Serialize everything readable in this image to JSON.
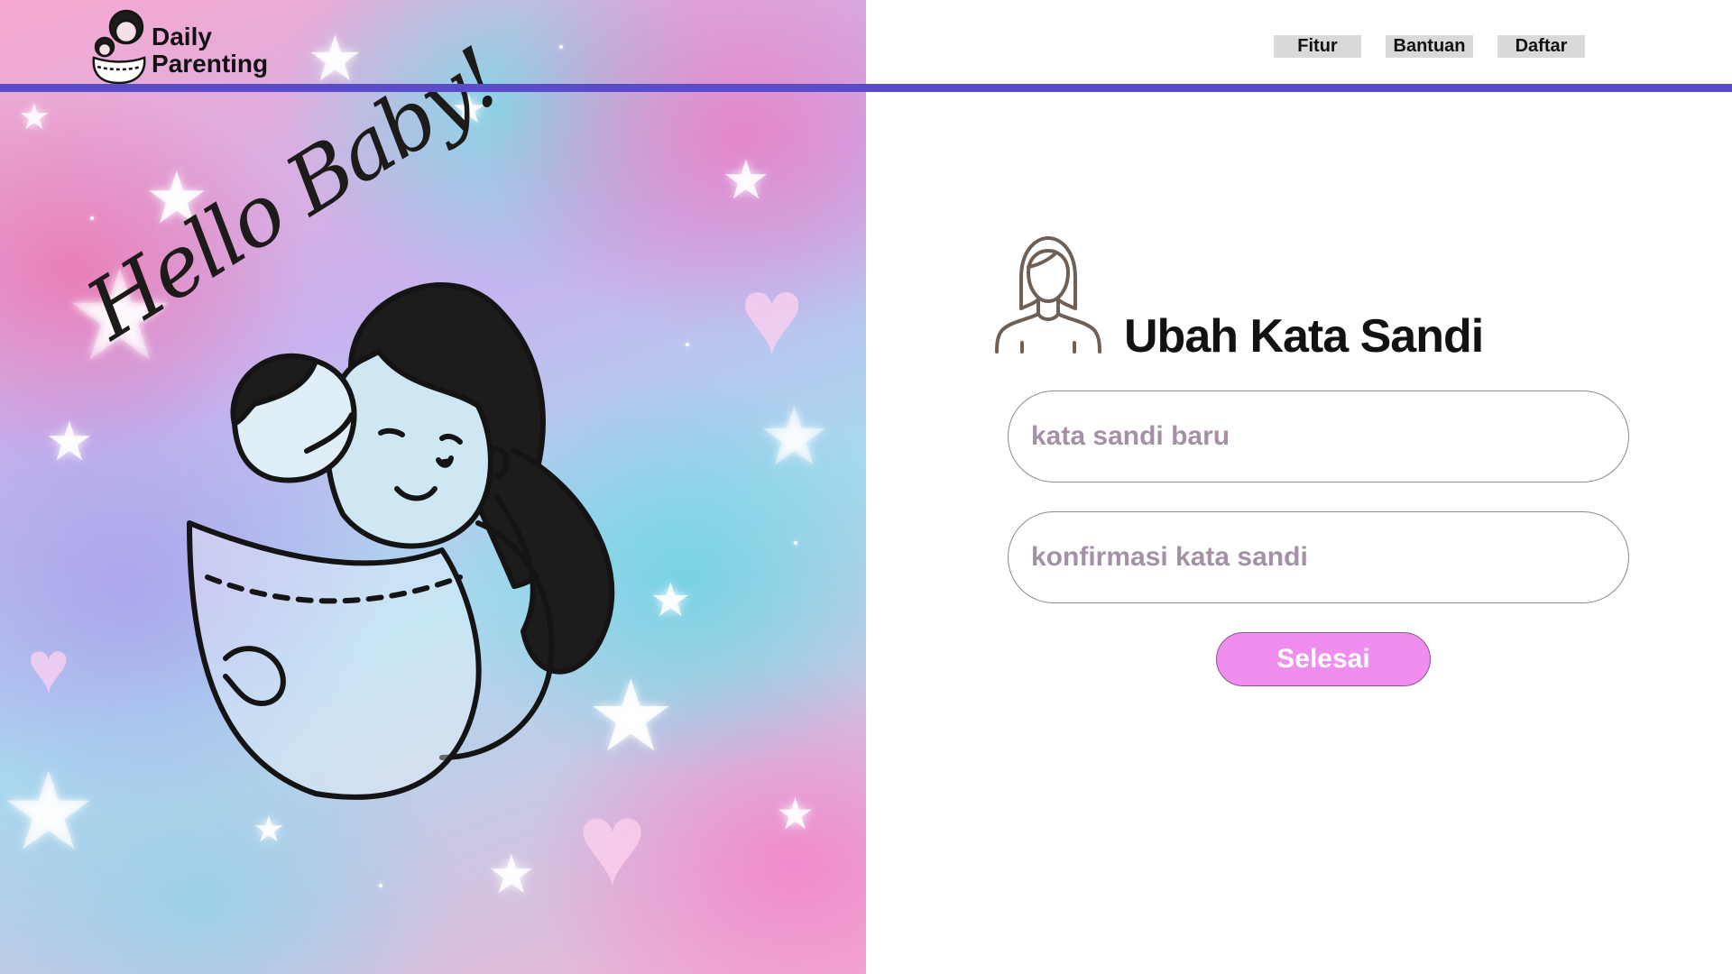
{
  "brand": {
    "line1": "Daily",
    "line2": "Parenting"
  },
  "nav": {
    "items": [
      {
        "label": "Fitur"
      },
      {
        "label": "Bantuan"
      },
      {
        "label": "Daftar"
      }
    ]
  },
  "art": {
    "caption": "Hello Baby!"
  },
  "form": {
    "title": "Ubah Kata Sandi",
    "new_password_placeholder": "kata sandi baru",
    "confirm_password_placeholder": "konfirmasi kata sandi",
    "submit_label": "Selesai"
  },
  "colors": {
    "header_bar": "#5a4bc8",
    "submit_button": "#f08ef0",
    "placeholder_text": "#a591a5",
    "nav_button_bg": "#d9d9d9"
  },
  "icons": {
    "logo": "mother-baby-logo-icon",
    "user": "woman-user-icon"
  }
}
